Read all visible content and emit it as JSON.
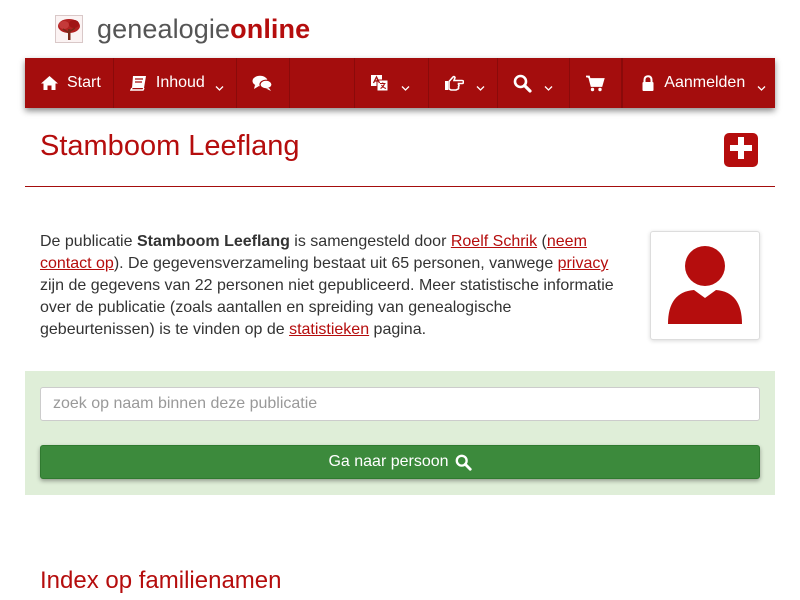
{
  "brand": {
    "name_part1": "genealogie",
    "name_part2": "online",
    "accent_color": "#b50d0d"
  },
  "nav": {
    "start_label": "Start",
    "inhoud_label": "Inhoud",
    "aanmelden_label": "Aanmelden",
    "icons": [
      "home-icon",
      "book-icon",
      "comments-icon",
      "language-icon",
      "hand-point-icon",
      "search-icon",
      "cart-icon",
      "lock-icon"
    ]
  },
  "page": {
    "title": "Stamboom Leeflang"
  },
  "description": {
    "t1": "De publicatie ",
    "publication": "Stamboom Leeflang",
    "t2": " is samengesteld door ",
    "author_link": "Roelf Schrik",
    "t3": " (",
    "contact_link": "neem contact op",
    "t4": "). De gegevensverzameling bestaat uit 65 personen, vanwege ",
    "privacy_link": "privacy",
    "t5": " zijn de gegevens van 22 personen niet gepubliceerd. Meer statistische informatie over de publicatie (zoals aantallen en spreiding van genealogische gebeurtenissen) is te vinden op de ",
    "stats_link": "statistieken",
    "t6": " pagina."
  },
  "search": {
    "placeholder": "zoek op naam binnen deze publicatie",
    "button_label": "Ga naar persoon",
    "panel_color": "#dfeed8",
    "button_color": "#3c8a3c"
  },
  "index": {
    "title": "Index op familienamen"
  }
}
